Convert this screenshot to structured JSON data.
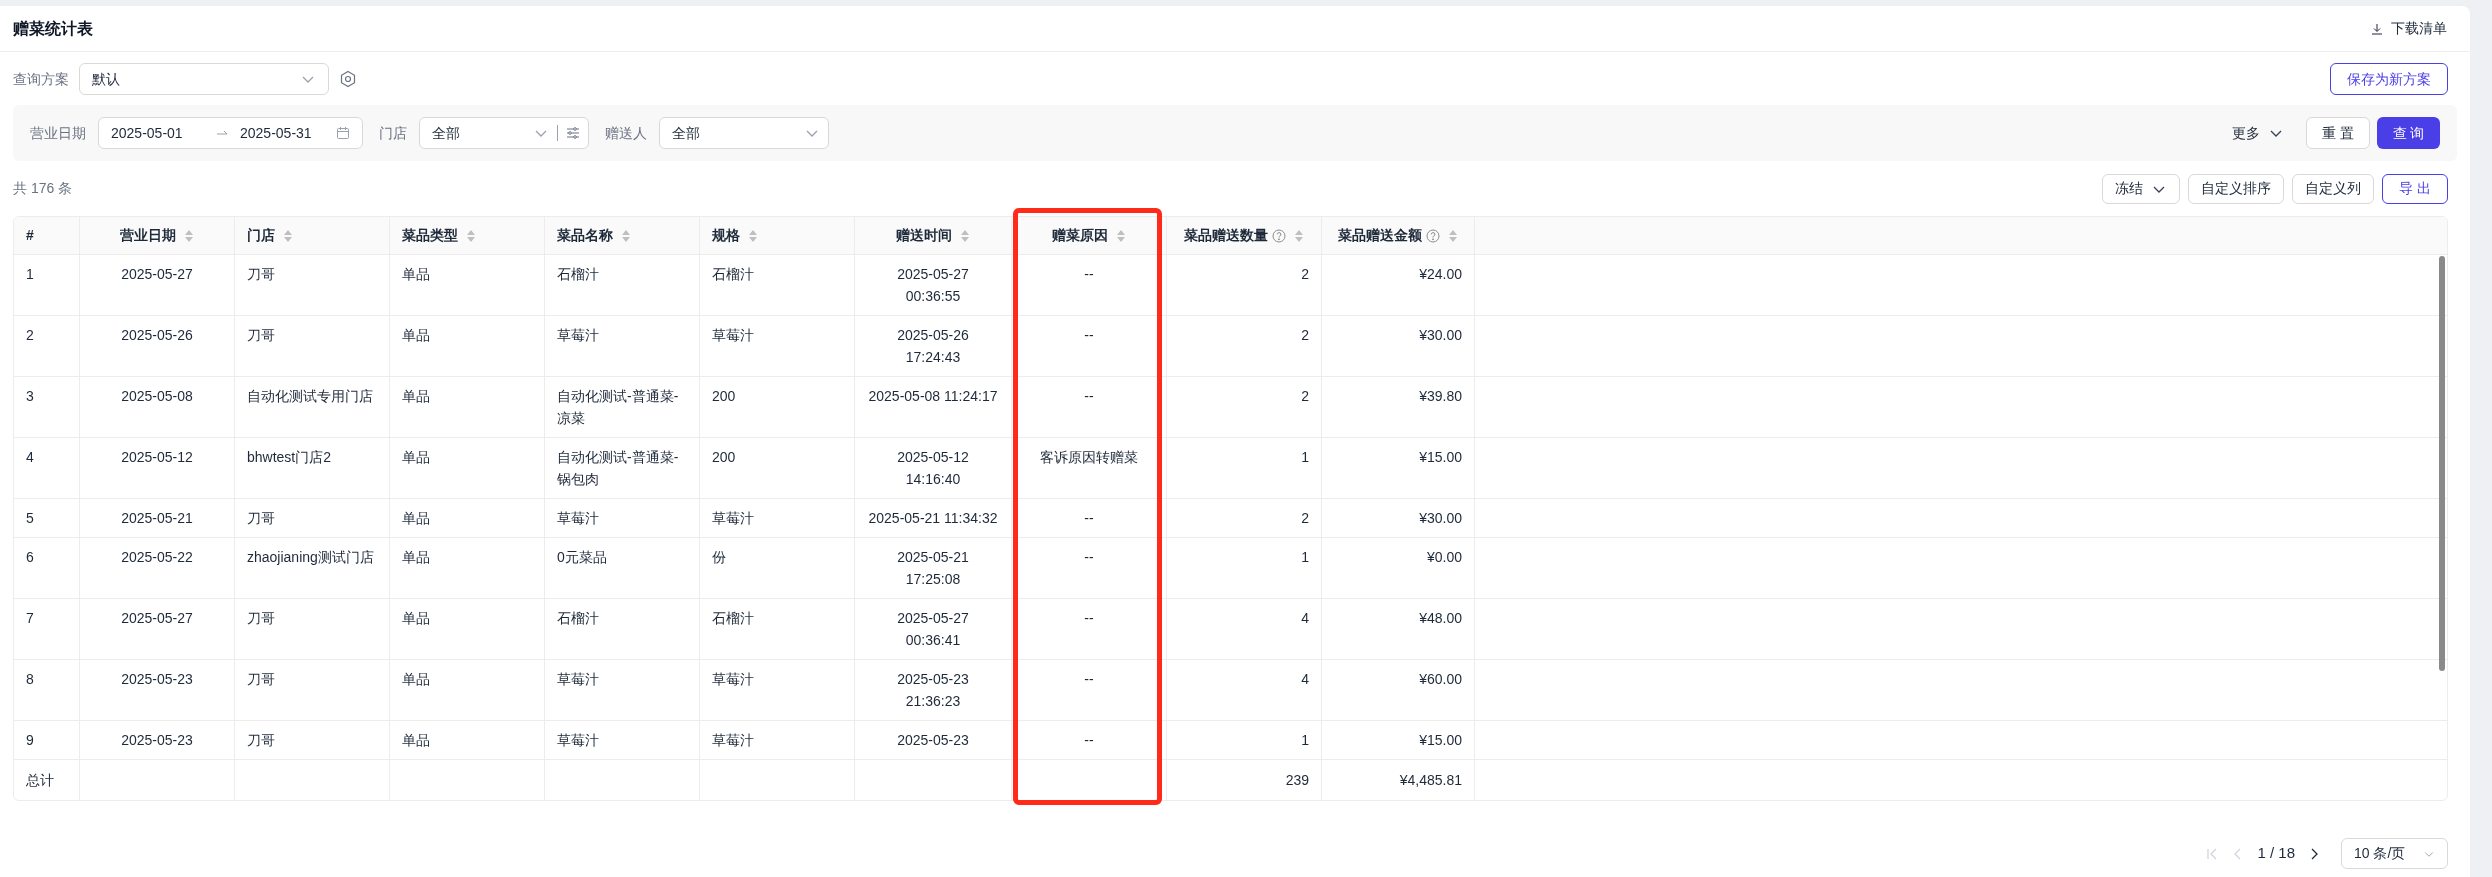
{
  "page": {
    "title": "赠菜统计表",
    "download_label": "下载清单"
  },
  "scheme": {
    "label": "查询方案",
    "value": "默认",
    "save_label": "保存为新方案"
  },
  "filters": [
    {
      "kind": "daterange",
      "label": "营业日期",
      "start": "2025-05-01",
      "end": "2025-05-31"
    },
    {
      "kind": "select_filter",
      "label": "门店",
      "value": "全部"
    },
    {
      "kind": "select",
      "label": "赠送人",
      "value": "全部"
    }
  ],
  "actions": {
    "more_label": "更多",
    "reset_label": "重 置",
    "query_label": "查 询"
  },
  "total_count": "共 176 条",
  "toolbar": [
    {
      "kind": "dropdown",
      "label": "冻结"
    },
    {
      "kind": "plain",
      "label": "自定义排序"
    },
    {
      "kind": "plain",
      "label": "自定义列"
    },
    {
      "kind": "primary_outline",
      "label": "导 出"
    }
  ],
  "table": {
    "columns": [
      {
        "label": "#",
        "sortable": false,
        "help": false,
        "highlighted": false
      },
      {
        "label": "营业日期",
        "sortable": true,
        "help": false,
        "highlighted": false
      },
      {
        "label": "门店",
        "sortable": true,
        "help": false,
        "highlighted": false
      },
      {
        "label": "菜品类型",
        "sortable": true,
        "help": false,
        "highlighted": false
      },
      {
        "label": "菜品名称",
        "sortable": true,
        "help": false,
        "highlighted": false
      },
      {
        "label": "规格",
        "sortable": true,
        "help": false,
        "highlighted": false
      },
      {
        "label": "赠送时间",
        "sortable": true,
        "help": false,
        "highlighted": false
      },
      {
        "label": "赠菜原因",
        "sortable": true,
        "help": false,
        "highlighted": true
      },
      {
        "label": "菜品赠送数量",
        "sortable": true,
        "help": true,
        "highlighted": false
      },
      {
        "label": "菜品赠送金额",
        "sortable": true,
        "help": true,
        "highlighted": false
      }
    ],
    "rows": [
      [
        "1",
        "2025-05-27",
        "刀哥",
        "单品",
        "石榴汁",
        "石榴汁",
        "2025-05-27\n00:36:55",
        "--",
        "2",
        "¥24.00"
      ],
      [
        "2",
        "2025-05-26",
        "刀哥",
        "单品",
        "草莓汁",
        "草莓汁",
        "2025-05-26\n17:24:43",
        "--",
        "2",
        "¥30.00"
      ],
      [
        "3",
        "2025-05-08",
        "自动化测试专用门店",
        "单品",
        "自动化测试-普通菜-\n凉菜",
        "200",
        "2025-05-08 11:24:17",
        "--",
        "2",
        "¥39.80"
      ],
      [
        "4",
        "2025-05-12",
        "bhwtest门店2",
        "单品",
        "自动化测试-普通菜-\n锅包肉",
        "200",
        "2025-05-12\n14:16:40",
        "客诉原因转赠菜",
        "1",
        "¥15.00"
      ],
      [
        "5",
        "2025-05-21",
        "刀哥",
        "单品",
        "草莓汁",
        "草莓汁",
        "2025-05-21 11:34:32",
        "--",
        "2",
        "¥30.00"
      ],
      [
        "6",
        "2025-05-22",
        "zhaojianing测试门店",
        "单品",
        "0元菜品",
        "份",
        "2025-05-21\n17:25:08",
        "--",
        "1",
        "¥0.00"
      ],
      [
        "7",
        "2025-05-27",
        "刀哥",
        "单品",
        "石榴汁",
        "石榴汁",
        "2025-05-27\n00:36:41",
        "--",
        "4",
        "¥48.00"
      ],
      [
        "8",
        "2025-05-23",
        "刀哥",
        "单品",
        "草莓汁",
        "草莓汁",
        "2025-05-23\n21:36:23",
        "--",
        "4",
        "¥60.00"
      ],
      [
        "9",
        "2025-05-23",
        "刀哥",
        "单品",
        "草莓汁",
        "草莓汁",
        "2025-05-23",
        "--",
        "1",
        "¥15.00"
      ]
    ],
    "total": {
      "label": "总计",
      "quantity": "239",
      "amount": "¥4,485.81"
    }
  },
  "pagination": {
    "buttons": [
      {
        "kind": "first",
        "disabled": true
      },
      {
        "kind": "prev",
        "disabled": true
      },
      {
        "kind": "next",
        "disabled": false
      }
    ],
    "page_text": "1 / 18",
    "page_size": "10 条/页"
  }
}
